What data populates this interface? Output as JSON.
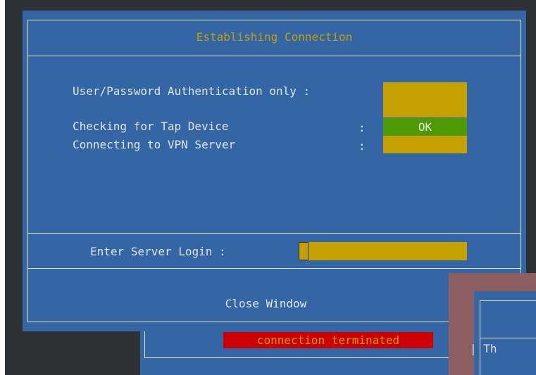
{
  "dialog": {
    "title": "Establishing Connection",
    "rows": [
      {
        "label": "User/Password Authentication only :",
        "status": ""
      },
      {
        "label": "Checking for Tap Device",
        "separator": ":",
        "status": "OK"
      },
      {
        "label": "Connecting to VPN Server",
        "separator": ":",
        "status": ""
      }
    ],
    "login_label": "Enter Server Login :",
    "login_value": "",
    "close_label": "Close Window"
  },
  "background_window": {
    "status_text": "connection terminated"
  },
  "overlay_window": {
    "partial_text": "| Th"
  },
  "colors": {
    "terminal_bg": "#2e3133",
    "dialog_bg": "#3465a4",
    "accent_yellow": "#c4a000",
    "ok_green": "#4e9a06",
    "error_red": "#cc0000",
    "overlay_shadow": "#8b5e60",
    "text": "#dfe6ee"
  }
}
